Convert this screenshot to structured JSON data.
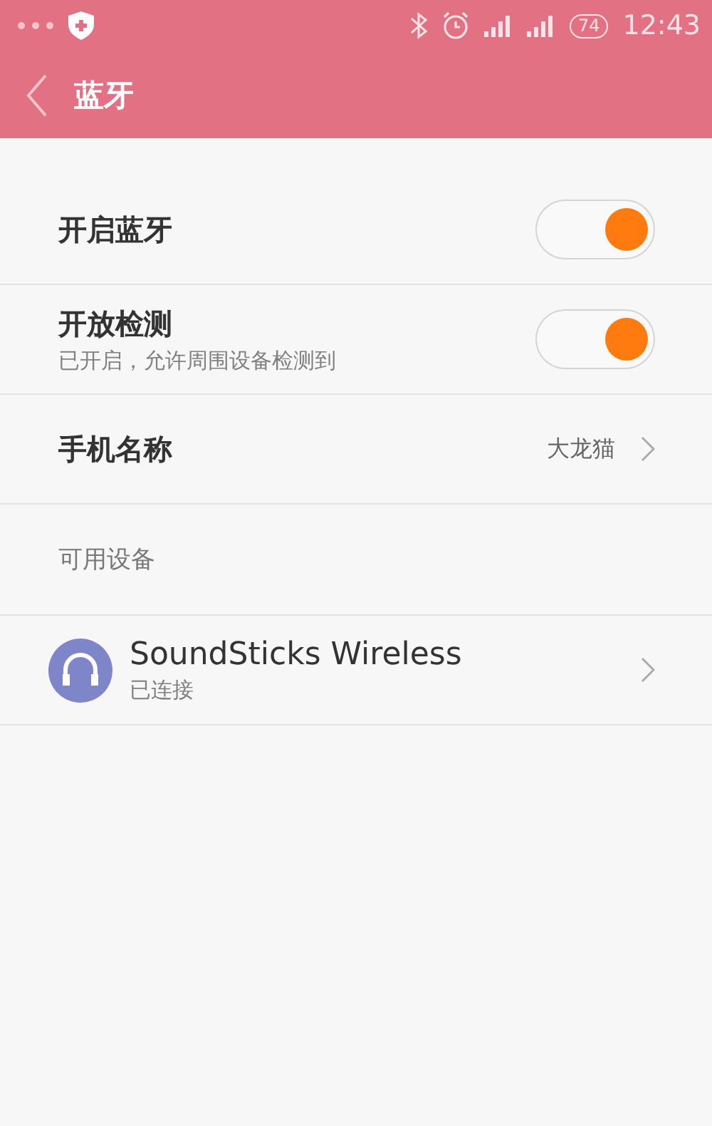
{
  "status_bar": {
    "time": "12:43",
    "battery": "74"
  },
  "header": {
    "title": "蓝牙"
  },
  "settings": [
    {
      "kind": "toggle",
      "label": "开启蓝牙",
      "on": true
    },
    {
      "kind": "toggle",
      "label": "开放检测",
      "sublabel": "已开启，允许周围设备检测到",
      "on": true
    },
    {
      "kind": "link",
      "label": "手机名称",
      "value": "大龙猫"
    }
  ],
  "section_title": "可用设备",
  "devices": [
    {
      "name": "SoundSticks Wireless",
      "status": "已连接"
    }
  ]
}
